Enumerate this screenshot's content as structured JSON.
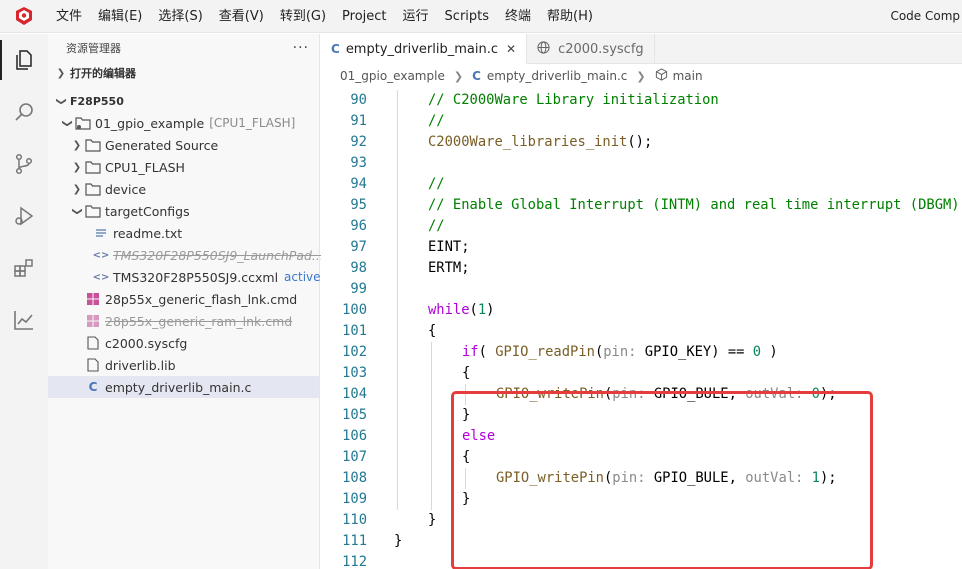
{
  "menubar": {
    "items": [
      "文件",
      "编辑(E)",
      "选择(S)",
      "查看(V)",
      "转到(G)",
      "Project",
      "运行",
      "Scripts",
      "终端",
      "帮助(H)"
    ],
    "window_title": "Code Comp"
  },
  "activity_bar": {
    "icons": [
      "explorer-icon",
      "search-icon",
      "source-control-icon",
      "run-debug-icon",
      "extensions-icon",
      "chart-icon"
    ]
  },
  "sidebar": {
    "header": "资源管理器",
    "open_editors": "打开的编辑器",
    "project_section": "F28P550",
    "tree": [
      {
        "label": "01_gpio_example",
        "suffix": "[CPU1_FLASH]"
      },
      {
        "label": "Generated Source"
      },
      {
        "label": "CPU1_FLASH"
      },
      {
        "label": "device"
      },
      {
        "label": "targetConfigs"
      },
      {
        "label": "readme.txt"
      },
      {
        "label": "TMS320F28P550SJ9_LaunchPad..."
      },
      {
        "label": "TMS320F28P550SJ9.ccxml",
        "badge": "active"
      },
      {
        "label": "28p55x_generic_flash_lnk.cmd"
      },
      {
        "label": "28p55x_generic_ram_lnk.cmd"
      },
      {
        "label": "c2000.syscfg"
      },
      {
        "label": "driverlib.lib"
      },
      {
        "label": "empty_driverlib_main.c"
      }
    ]
  },
  "editor": {
    "tabs": [
      {
        "label": "empty_driverlib_main.c",
        "icon": "C",
        "close": "✕"
      },
      {
        "label": "c2000.syscfg"
      }
    ],
    "breadcrumb": [
      "01_gpio_example",
      "empty_driverlib_main.c",
      "main"
    ],
    "code": {
      "line_numbers": [
        "90",
        "91",
        "92",
        "93",
        "94",
        "95",
        "96",
        "97",
        "98",
        "99",
        "100",
        "101",
        "102",
        "103",
        "104",
        "105",
        "106",
        "107",
        "108",
        "109",
        "110",
        "111",
        "112"
      ],
      "l90": "// C2000Ware Library initialization",
      "l91": "//",
      "l92_fn": "C2000Ware_libraries_init",
      "l92_rest": "();",
      "l94": "//",
      "l95": "// Enable Global Interrupt (INTM) and real time interrupt (DBGM)",
      "l96": "//",
      "l97": "EINT;",
      "l98": "ERTM;",
      "l100_kw": "while",
      "l100_paren_open": "(",
      "l100_num": "1",
      "l100_paren_close": ")",
      "brace_open": "{",
      "brace_close": "}",
      "l102_kw": "if",
      "l102_a": "( ",
      "l102_fn": "GPIO_readPin",
      "l102_b": "(",
      "l102_hint": "pin:",
      "l102_arg": " GPIO_KEY",
      "l102_c": ") == ",
      "l102_num": "0",
      "l102_d": " )",
      "write_fn": "GPIO_writePin",
      "paren": "(",
      "pin_hint": "pin:",
      "write_arg": " GPIO_BULE, ",
      "outval_hint": "outVal:",
      "l104_num": " 0",
      "l108_num": " 1",
      "close_semi": ");",
      "l106_kw": "else"
    }
  }
}
